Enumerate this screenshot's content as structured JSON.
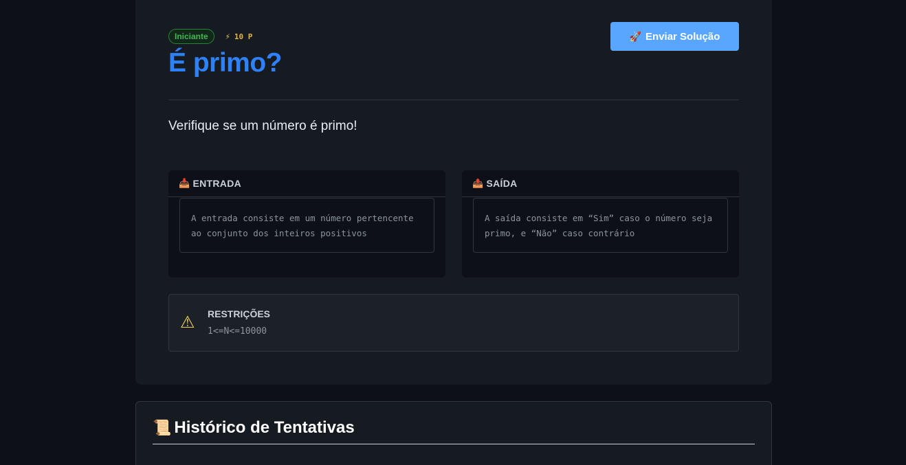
{
  "problem": {
    "level": "Iniciante",
    "points": "10 P",
    "title": "É primo?",
    "submit_label": "Enviar Solução",
    "description": "Verifique se um número é primo!",
    "entrada": {
      "label": "ENTRADA",
      "content": "A entrada consiste em um número pertencente ao conjunto dos inteiros positivos"
    },
    "saida": {
      "label": "SAÍDA",
      "content": "A saída consiste em “Sim” caso o número seja primo, e “Não” caso contrário"
    },
    "restrictions": {
      "label": "RESTRIÇÕES",
      "value": "1<=N<=10000"
    }
  },
  "history": {
    "title": "Histórico de Tentativas"
  },
  "icons": {
    "points": "lightning-icon",
    "submit": "rocket-icon",
    "entrada": "inbox-tray-icon",
    "saida": "outbox-tray-icon",
    "restrictions": "warning-icon",
    "history": "scroll-icon"
  },
  "colors": {
    "accent": "#2f81f7",
    "button": "#58a6ff",
    "level_badge": "#3fb950",
    "points": "#e3b341",
    "warning": "#f2cc60"
  }
}
